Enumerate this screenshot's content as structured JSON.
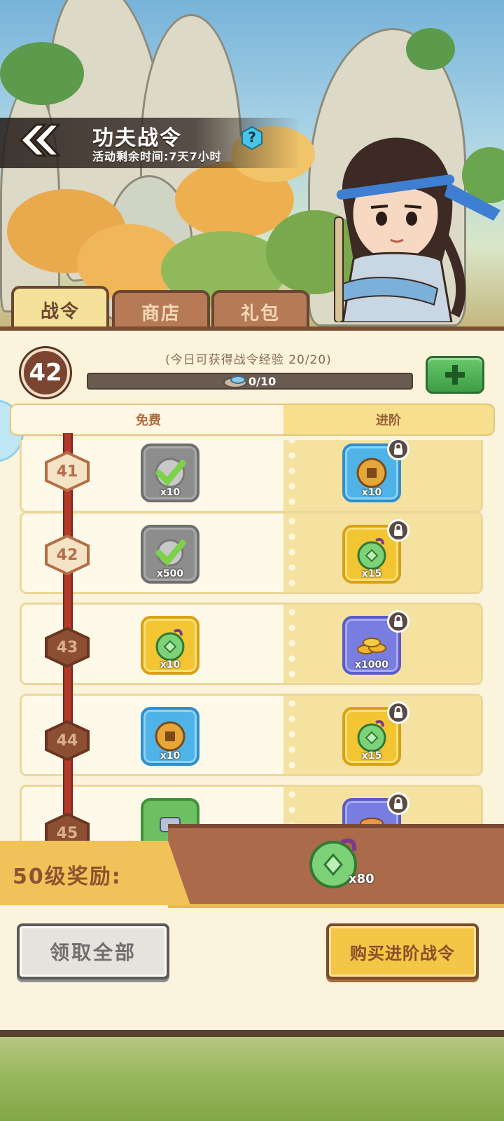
{
  "header": {
    "title": "功夫战令",
    "subtitle": "活动剩余时间:7天7小时",
    "help_symbol": "?"
  },
  "tabs": [
    {
      "label": "战令",
      "active": true
    },
    {
      "label": "商店",
      "active": false
    },
    {
      "label": "礼包",
      "active": false
    }
  ],
  "progress": {
    "level": "42",
    "daily_note": "(今日可获得战令经验 20/20)",
    "exp_text": "0/10",
    "exp_fraction": 0
  },
  "columns": {
    "free": "免费",
    "advanced": "进阶"
  },
  "rewards": [
    {
      "level": "41",
      "free_qty": "x10",
      "free_icon": "check-token-icon",
      "adv_qty": "x10",
      "adv_icon": "coin-icon"
    },
    {
      "level": "42",
      "free_qty": "x500",
      "free_icon": "check-token-icon",
      "adv_qty": "x15",
      "adv_icon": "jade-pouch-icon"
    },
    {
      "level": "43",
      "free_qty": "x10",
      "free_icon": "jade-pouch-icon",
      "adv_qty": "x1000",
      "adv_icon": "gold-coins-icon"
    },
    {
      "level": "44",
      "free_qty": "x10",
      "free_icon": "coin-icon",
      "adv_qty": "x15",
      "adv_icon": "jade-pouch-icon"
    },
    {
      "level": "45",
      "free_qty": "",
      "free_icon": "green-item-icon",
      "adv_qty": "",
      "adv_icon": "purple-item-icon"
    }
  ],
  "final_reward": {
    "label": "50级奖励:",
    "qty": "x80",
    "icon": "jade-pouch-icon"
  },
  "buttons": {
    "claim_all": "领取全部",
    "buy_advanced": "购买进阶战令"
  },
  "colors": {
    "panel": "#fbf3dc",
    "accent_brown": "#7a4d35",
    "gold": "#f3c533",
    "green": "#4fae52"
  }
}
